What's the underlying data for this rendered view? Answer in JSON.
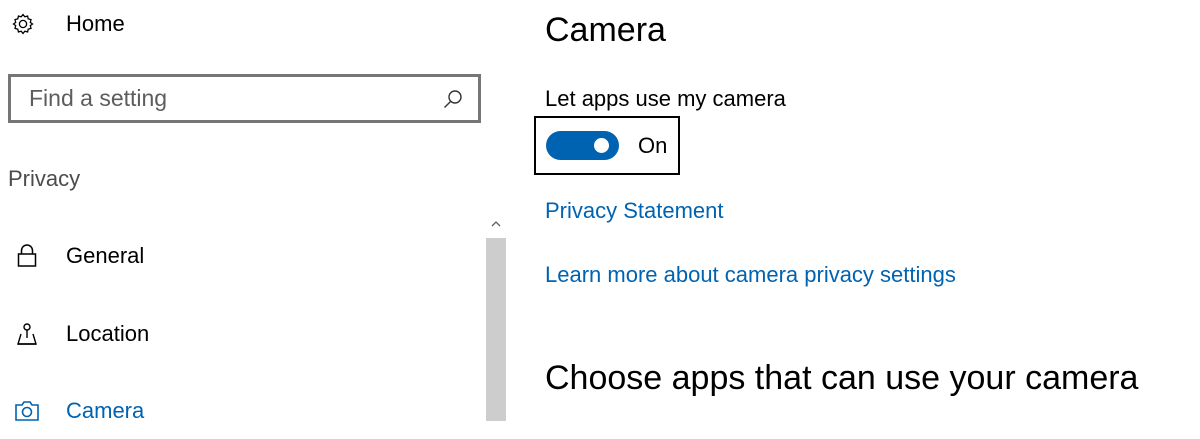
{
  "sidebar": {
    "home": {
      "label": "Home",
      "icon": "gear-icon"
    },
    "search": {
      "placeholder": "Find a setting",
      "value": "",
      "icon": "search-icon"
    },
    "section_label": "Privacy",
    "items": [
      {
        "label": "General",
        "icon": "lock-icon",
        "selected": false
      },
      {
        "label": "Location",
        "icon": "location-pin-icon",
        "selected": false
      },
      {
        "label": "Camera",
        "icon": "camera-icon",
        "selected": true
      }
    ],
    "scrollbar": {
      "up_icon": "chevron-up-icon"
    }
  },
  "main": {
    "title": "Camera",
    "setting_label": "Let apps use my camera",
    "toggle": {
      "state": "On",
      "on": true
    },
    "links": {
      "privacy_statement": "Privacy Statement",
      "learn_more": "Learn more about camera privacy settings"
    },
    "section_heading": "Choose apps that can use your camera"
  },
  "colors": {
    "accent": "#0063b1",
    "search_border": "#767676",
    "scroll_thumb": "#cdcdcd"
  }
}
